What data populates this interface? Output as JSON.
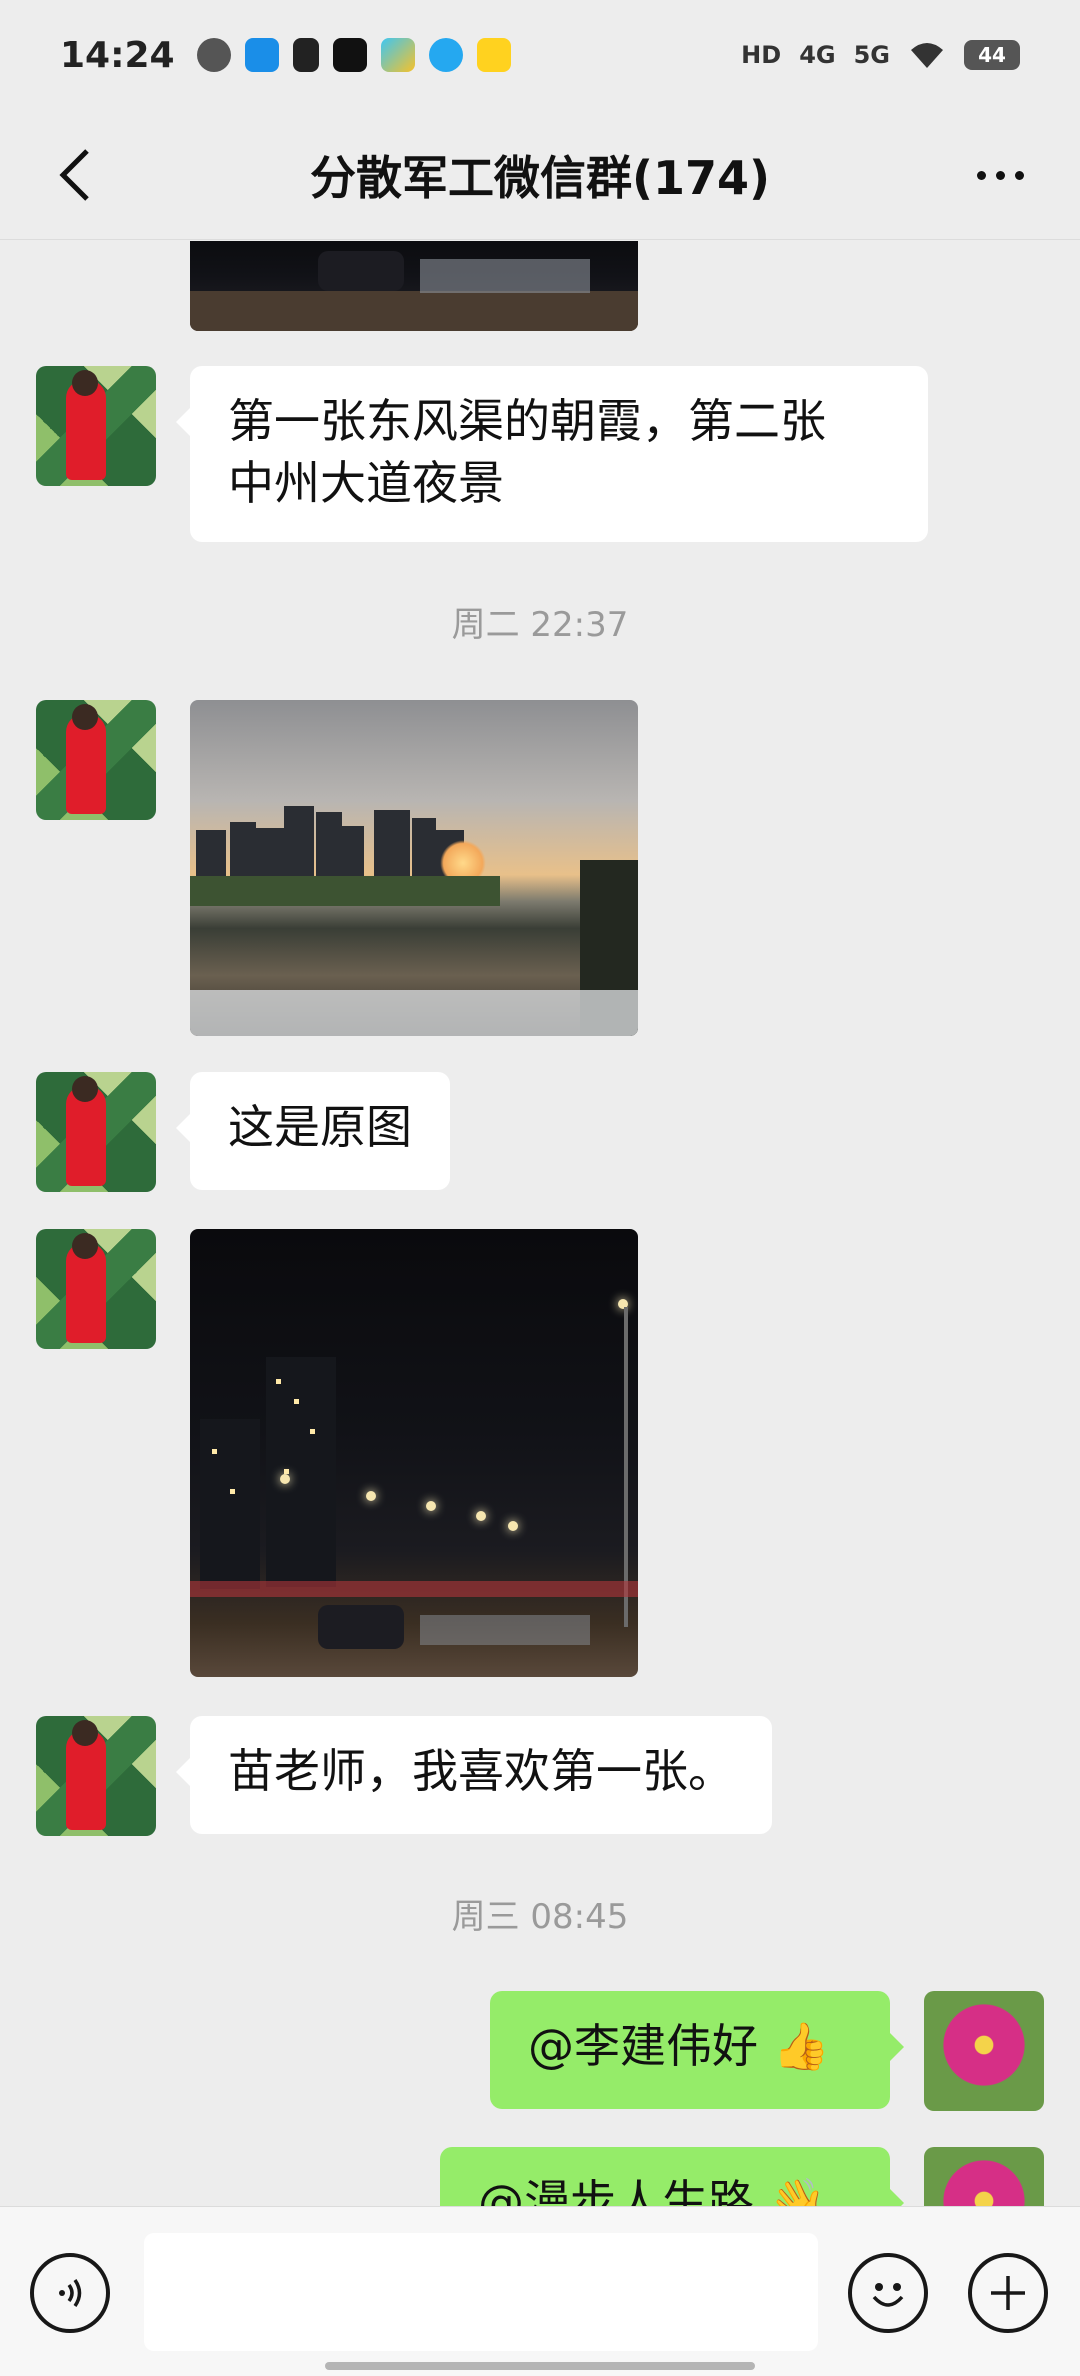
{
  "status_bar": {
    "time": "14:24",
    "icons": [
      "chat-icon",
      "bilibili-icon",
      "tiktok-icon",
      "capcut-icon",
      "video-icon",
      "qq-icon",
      "meituan-icon"
    ],
    "hd": "HD",
    "signal_4g": "4G",
    "signal_5g": "5G",
    "battery": "44"
  },
  "header": {
    "title": "分散军工微信群(174)"
  },
  "chat": {
    "messages": [
      {
        "type": "text",
        "sender": "left",
        "text_line1": "第一张东风渠的朝霞，第二张",
        "text_line2": "中州大道夜景"
      },
      {
        "type": "time",
        "text": "周二 22:37"
      },
      {
        "type": "image",
        "sender": "left",
        "subject": "sunset-river-photo"
      },
      {
        "type": "text",
        "sender": "left",
        "text": "这是原图"
      },
      {
        "type": "image",
        "sender": "left",
        "subject": "night-street-photo"
      },
      {
        "type": "text",
        "sender": "left",
        "text": "苗老师，我喜欢第一张。"
      },
      {
        "type": "time",
        "text": "周三 08:45"
      },
      {
        "type": "text",
        "sender": "right",
        "text": "@李建伟好 👍"
      },
      {
        "type": "text",
        "sender": "right",
        "text": "@漫步人生路 👋"
      }
    ]
  },
  "input_bar": {
    "placeholder": ""
  },
  "colors": {
    "background": "#ededed",
    "bubble_self": "#95ec69",
    "bubble_other": "#ffffff"
  }
}
